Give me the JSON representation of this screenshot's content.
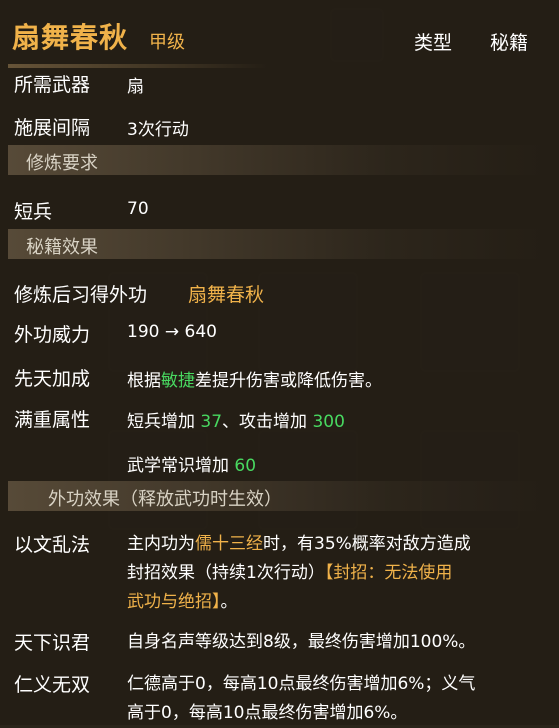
{
  "title": {
    "name": "扇舞春秋",
    "grade": "甲级",
    "type_label": "类型",
    "type_value": "秘籍"
  },
  "basic": [
    {
      "label": "所需武器",
      "value": "扇"
    },
    {
      "label": "施展间隔",
      "value": "3次行动"
    }
  ],
  "requirements": {
    "header": "修炼要求",
    "label": "短兵",
    "value": "70"
  },
  "effects": {
    "header": "秘籍效果",
    "learn_label": "修炼后习得外功",
    "learn_value": "扇舞春秋",
    "power_label": "外功威力",
    "power_value": "190 → 640",
    "innate_label": "先天加成",
    "innate_pre": "根据",
    "innate_attr": "敏捷",
    "innate_post": "差提升伤害或降低伤害。",
    "mastery_label": "满重属性",
    "mastery_1_text": "短兵增加 ",
    "mastery_1_val": "37",
    "mastery_sep": "、攻击增加 ",
    "mastery_2_val": "300",
    "mastery_3_text": "武学常识增加 ",
    "mastery_3_val": "60"
  },
  "martial_effects": {
    "header": "外功效果（释放武功时生效）",
    "items": [
      {
        "label": "以文乱法",
        "line1_pre": "主内功为",
        "line1_gold": "儒十三经",
        "line1_post": "时，有35%概率对敌方造成",
        "line2_pre": "封招效果（持续1次行动）",
        "line2_gold": "【封招：无法使用",
        "line3_gold": "武功与绝招】",
        "line3_post": "。"
      },
      {
        "label": "天下识君",
        "text": "自身名声等级达到8级，最终伤害增加100%。"
      },
      {
        "label": "仁义无双",
        "line1": "仁德高于0，每高10点最终伤害增加6%；义气",
        "line2": "高于0，每高10点最终伤害增加6%。"
      }
    ]
  },
  "colors": {
    "gold": "#f0b24a",
    "green": "#48d860",
    "bg": "#241e16"
  }
}
